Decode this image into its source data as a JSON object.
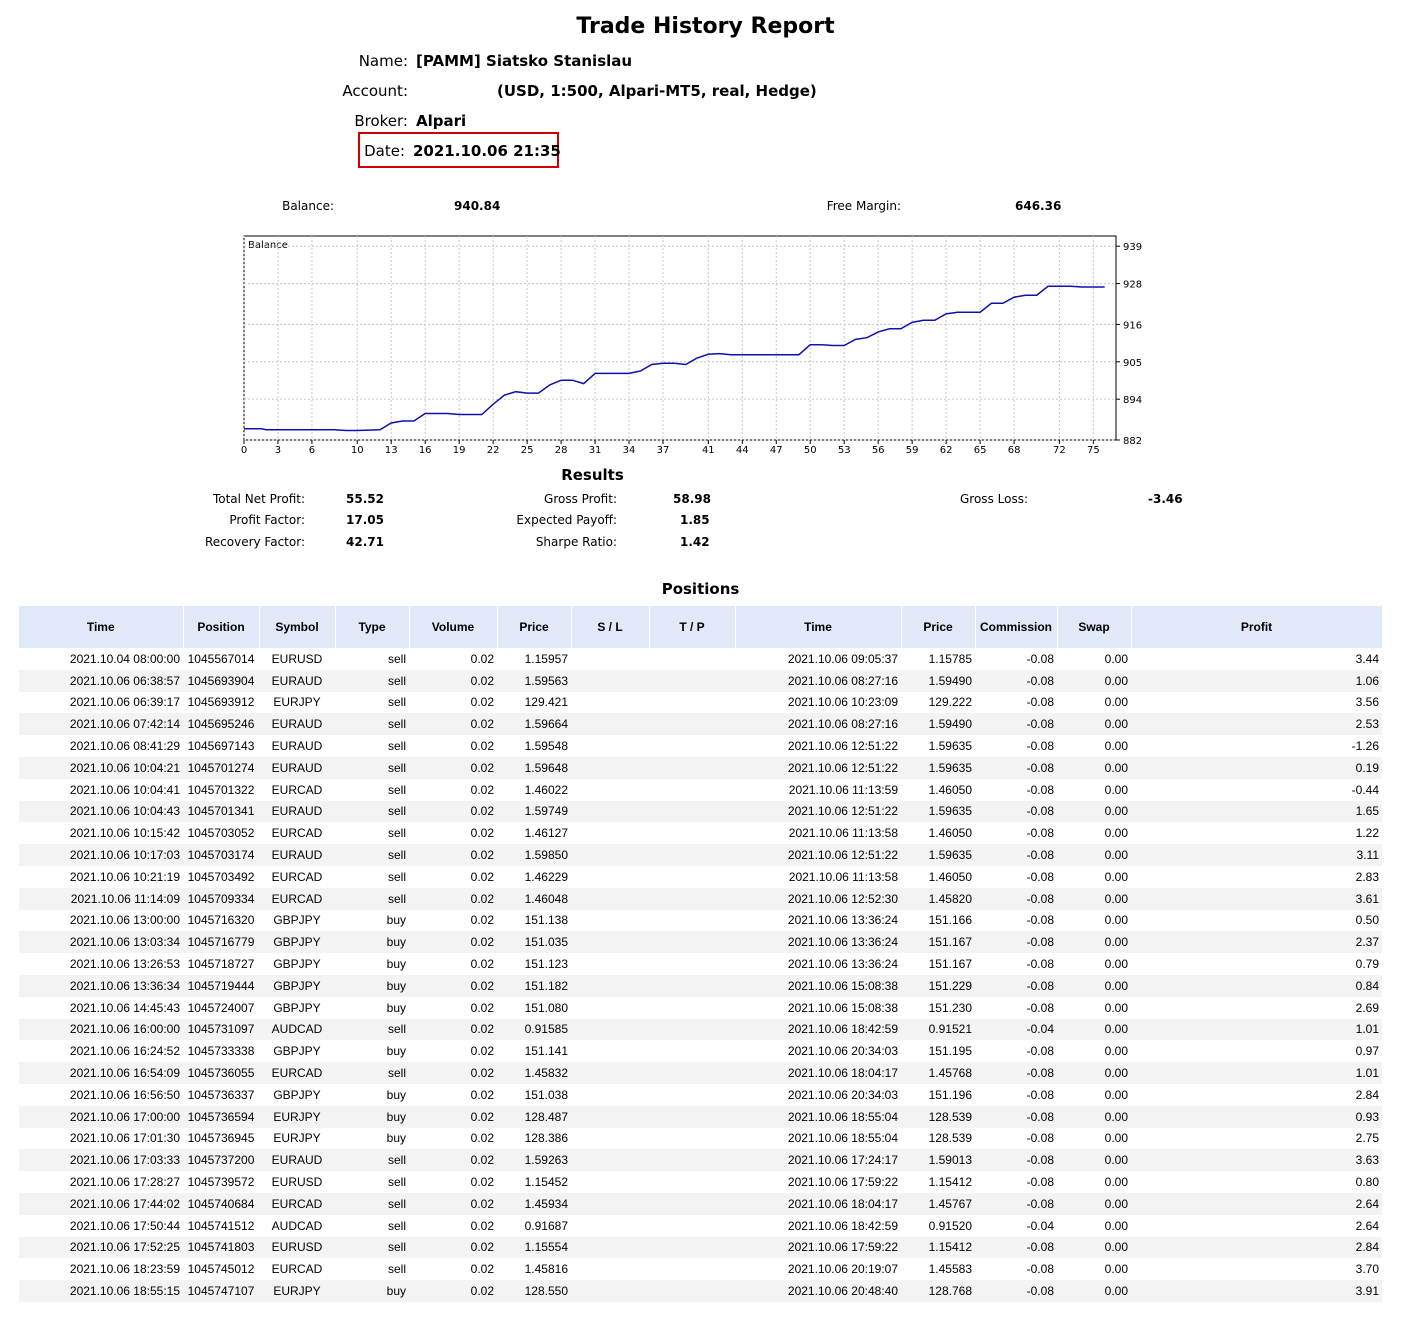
{
  "report": {
    "title": "Trade History Report",
    "name_label": "Name:",
    "name_value": "[PAMM] Siatsko Stanislau",
    "account_label": "Account:",
    "account_value": "(USD, 1:500, Alpari-MT5, real, Hedge)",
    "broker_label": "Broker:",
    "broker_value": "Alpari",
    "date_label": "Date:",
    "date_value": "2021.10.06 21:35"
  },
  "summary": {
    "balance_label": "Balance:",
    "balance_value": "940.84",
    "free_margin_label": "Free Margin:",
    "free_margin_value": "646.36"
  },
  "chart_data": {
    "type": "line",
    "title": "Balance",
    "xlabel": "",
    "ylabel": "",
    "x_ticks": [
      0,
      3,
      6,
      10,
      13,
      16,
      19,
      22,
      25,
      28,
      31,
      34,
      37,
      41,
      44,
      47,
      50,
      53,
      56,
      59,
      62,
      65,
      68,
      72,
      75
    ],
    "y_ticks": [
      882,
      894,
      905,
      916,
      928,
      939
    ],
    "xlim": [
      0,
      77
    ],
    "ylim": [
      882,
      942
    ],
    "grid": true,
    "line_color": "#1010b0",
    "series": [
      {
        "x": [
          0,
          1.5,
          2,
          8,
          9,
          10,
          12,
          13,
          14,
          15,
          16,
          18,
          19,
          21,
          22,
          23,
          24,
          25,
          26,
          27,
          28,
          29,
          30,
          31,
          32,
          33,
          34,
          35,
          36,
          37,
          38,
          39,
          40,
          41,
          42,
          43,
          44,
          45,
          46,
          47,
          48,
          49,
          50,
          51,
          52,
          53,
          54,
          55,
          56,
          57,
          58,
          59,
          60,
          61,
          62,
          63,
          64,
          65,
          66,
          67,
          68,
          69,
          70,
          71,
          72,
          73,
          74,
          75,
          76
        ],
        "values": [
          885.3,
          885.3,
          885.0,
          885.0,
          884.8,
          884.8,
          885.0,
          887.0,
          887.6,
          887.6,
          889.8,
          889.8,
          889.5,
          889.5,
          892.5,
          895.2,
          896.2,
          895.8,
          895.8,
          898.2,
          899.6,
          899.6,
          898.6,
          901.6,
          901.6,
          901.6,
          901.6,
          902.3,
          904.2,
          904.6,
          904.6,
          904.2,
          906.1,
          907.2,
          907.4,
          907.1,
          907.1,
          907.1,
          907.1,
          907.1,
          907.1,
          907.1,
          910.0,
          910.0,
          909.8,
          909.8,
          911.6,
          912.1,
          913.8,
          914.7,
          914.7,
          916.6,
          917.2,
          917.2,
          919.1,
          919.6,
          919.6,
          919.6,
          922.2,
          922.2,
          924.0,
          924.6,
          924.6,
          927.2,
          927.2,
          927.2,
          927.0,
          927.0,
          927.0
        ]
      }
    ],
    "y_display_offset": 0
  },
  "results": {
    "title": "Results",
    "total_net_profit_label": "Total Net Profit:",
    "total_net_profit_value": "55.52",
    "gross_profit_label": "Gross Profit:",
    "gross_profit_value": "58.98",
    "gross_loss_label": "Gross Loss:",
    "gross_loss_value": "-3.46",
    "profit_factor_label": "Profit Factor:",
    "profit_factor_value": "17.05",
    "expected_payoff_label": "Expected Payoff:",
    "expected_payoff_value": "1.85",
    "recovery_factor_label": "Recovery Factor:",
    "recovery_factor_value": "42.71",
    "sharpe_ratio_label": "Sharpe Ratio:",
    "sharpe_ratio_value": "1.42"
  },
  "positions": {
    "title": "Positions",
    "columns": [
      "Time",
      "Position",
      "Symbol",
      "Type",
      "Volume",
      "Price",
      "S / L",
      "T / P",
      "Time",
      "Price",
      "Commission",
      "Swap",
      "Profit"
    ],
    "rows": [
      [
        "2021.10.04 08:00:00",
        "1045567014",
        "EURUSD",
        "sell",
        "0.02",
        "1.15957",
        "",
        "",
        "2021.10.06 09:05:37",
        "1.15785",
        "-0.08",
        "0.00",
        "3.44"
      ],
      [
        "2021.10.06 06:38:57",
        "1045693904",
        "EURAUD",
        "sell",
        "0.02",
        "1.59563",
        "",
        "",
        "2021.10.06 08:27:16",
        "1.59490",
        "-0.08",
        "0.00",
        "1.06"
      ],
      [
        "2021.10.06 06:39:17",
        "1045693912",
        "EURJPY",
        "sell",
        "0.02",
        "129.421",
        "",
        "",
        "2021.10.06 10:23:09",
        "129.222",
        "-0.08",
        "0.00",
        "3.56"
      ],
      [
        "2021.10.06 07:42:14",
        "1045695246",
        "EURAUD",
        "sell",
        "0.02",
        "1.59664",
        "",
        "",
        "2021.10.06 08:27:16",
        "1.59490",
        "-0.08",
        "0.00",
        "2.53"
      ],
      [
        "2021.10.06 08:41:29",
        "1045697143",
        "EURAUD",
        "sell",
        "0.02",
        "1.59548",
        "",
        "",
        "2021.10.06 12:51:22",
        "1.59635",
        "-0.08",
        "0.00",
        "-1.26"
      ],
      [
        "2021.10.06 10:04:21",
        "1045701274",
        "EURAUD",
        "sell",
        "0.02",
        "1.59648",
        "",
        "",
        "2021.10.06 12:51:22",
        "1.59635",
        "-0.08",
        "0.00",
        "0.19"
      ],
      [
        "2021.10.06 10:04:41",
        "1045701322",
        "EURCAD",
        "sell",
        "0.02",
        "1.46022",
        "",
        "",
        "2021.10.06 11:13:59",
        "1.46050",
        "-0.08",
        "0.00",
        "-0.44"
      ],
      [
        "2021.10.06 10:04:43",
        "1045701341",
        "EURAUD",
        "sell",
        "0.02",
        "1.59749",
        "",
        "",
        "2021.10.06 12:51:22",
        "1.59635",
        "-0.08",
        "0.00",
        "1.65"
      ],
      [
        "2021.10.06 10:15:42",
        "1045703052",
        "EURCAD",
        "sell",
        "0.02",
        "1.46127",
        "",
        "",
        "2021.10.06 11:13:58",
        "1.46050",
        "-0.08",
        "0.00",
        "1.22"
      ],
      [
        "2021.10.06 10:17:03",
        "1045703174",
        "EURAUD",
        "sell",
        "0.02",
        "1.59850",
        "",
        "",
        "2021.10.06 12:51:22",
        "1.59635",
        "-0.08",
        "0.00",
        "3.11"
      ],
      [
        "2021.10.06 10:21:19",
        "1045703492",
        "EURCAD",
        "sell",
        "0.02",
        "1.46229",
        "",
        "",
        "2021.10.06 11:13:58",
        "1.46050",
        "-0.08",
        "0.00",
        "2.83"
      ],
      [
        "2021.10.06 11:14:09",
        "1045709334",
        "EURCAD",
        "sell",
        "0.02",
        "1.46048",
        "",
        "",
        "2021.10.06 12:52:30",
        "1.45820",
        "-0.08",
        "0.00",
        "3.61"
      ],
      [
        "2021.10.06 13:00:00",
        "1045716320",
        "GBPJPY",
        "buy",
        "0.02",
        "151.138",
        "",
        "",
        "2021.10.06 13:36:24",
        "151.166",
        "-0.08",
        "0.00",
        "0.50"
      ],
      [
        "2021.10.06 13:03:34",
        "1045716779",
        "GBPJPY",
        "buy",
        "0.02",
        "151.035",
        "",
        "",
        "2021.10.06 13:36:24",
        "151.167",
        "-0.08",
        "0.00",
        "2.37"
      ],
      [
        "2021.10.06 13:26:53",
        "1045718727",
        "GBPJPY",
        "buy",
        "0.02",
        "151.123",
        "",
        "",
        "2021.10.06 13:36:24",
        "151.167",
        "-0.08",
        "0.00",
        "0.79"
      ],
      [
        "2021.10.06 13:36:34",
        "1045719444",
        "GBPJPY",
        "buy",
        "0.02",
        "151.182",
        "",
        "",
        "2021.10.06 15:08:38",
        "151.229",
        "-0.08",
        "0.00",
        "0.84"
      ],
      [
        "2021.10.06 14:45:43",
        "1045724007",
        "GBPJPY",
        "buy",
        "0.02",
        "151.080",
        "",
        "",
        "2021.10.06 15:08:38",
        "151.230",
        "-0.08",
        "0.00",
        "2.69"
      ],
      [
        "2021.10.06 16:00:00",
        "1045731097",
        "AUDCAD",
        "sell",
        "0.02",
        "0.91585",
        "",
        "",
        "2021.10.06 18:42:59",
        "0.91521",
        "-0.04",
        "0.00",
        "1.01"
      ],
      [
        "2021.10.06 16:24:52",
        "1045733338",
        "GBPJPY",
        "buy",
        "0.02",
        "151.141",
        "",
        "",
        "2021.10.06 20:34:03",
        "151.195",
        "-0.08",
        "0.00",
        "0.97"
      ],
      [
        "2021.10.06 16:54:09",
        "1045736055",
        "EURCAD",
        "sell",
        "0.02",
        "1.45832",
        "",
        "",
        "2021.10.06 18:04:17",
        "1.45768",
        "-0.08",
        "0.00",
        "1.01"
      ],
      [
        "2021.10.06 16:56:50",
        "1045736337",
        "GBPJPY",
        "buy",
        "0.02",
        "151.038",
        "",
        "",
        "2021.10.06 20:34:03",
        "151.196",
        "-0.08",
        "0.00",
        "2.84"
      ],
      [
        "2021.10.06 17:00:00",
        "1045736594",
        "EURJPY",
        "buy",
        "0.02",
        "128.487",
        "",
        "",
        "2021.10.06 18:55:04",
        "128.539",
        "-0.08",
        "0.00",
        "0.93"
      ],
      [
        "2021.10.06 17:01:30",
        "1045736945",
        "EURJPY",
        "buy",
        "0.02",
        "128.386",
        "",
        "",
        "2021.10.06 18:55:04",
        "128.539",
        "-0.08",
        "0.00",
        "2.75"
      ],
      [
        "2021.10.06 17:03:33",
        "1045737200",
        "EURAUD",
        "sell",
        "0.02",
        "1.59263",
        "",
        "",
        "2021.10.06 17:24:17",
        "1.59013",
        "-0.08",
        "0.00",
        "3.63"
      ],
      [
        "2021.10.06 17:28:27",
        "1045739572",
        "EURUSD",
        "sell",
        "0.02",
        "1.15452",
        "",
        "",
        "2021.10.06 17:59:22",
        "1.15412",
        "-0.08",
        "0.00",
        "0.80"
      ],
      [
        "2021.10.06 17:44:02",
        "1045740684",
        "EURCAD",
        "sell",
        "0.02",
        "1.45934",
        "",
        "",
        "2021.10.06 18:04:17",
        "1.45767",
        "-0.08",
        "0.00",
        "2.64"
      ],
      [
        "2021.10.06 17:50:44",
        "1045741512",
        "AUDCAD",
        "sell",
        "0.02",
        "0.91687",
        "",
        "",
        "2021.10.06 18:42:59",
        "0.91520",
        "-0.04",
        "0.00",
        "2.64"
      ],
      [
        "2021.10.06 17:52:25",
        "1045741803",
        "EURUSD",
        "sell",
        "0.02",
        "1.15554",
        "",
        "",
        "2021.10.06 17:59:22",
        "1.15412",
        "-0.08",
        "0.00",
        "2.84"
      ],
      [
        "2021.10.06 18:23:59",
        "1045745012",
        "EURCAD",
        "sell",
        "0.02",
        "1.45816",
        "",
        "",
        "2021.10.06 20:19:07",
        "1.45583",
        "-0.08",
        "0.00",
        "3.70"
      ],
      [
        "2021.10.06 18:55:15",
        "1045747107",
        "EURJPY",
        "buy",
        "0.02",
        "128.550",
        "",
        "",
        "2021.10.06 20:48:40",
        "128.768",
        "-0.08",
        "0.00",
        "3.91"
      ]
    ]
  }
}
